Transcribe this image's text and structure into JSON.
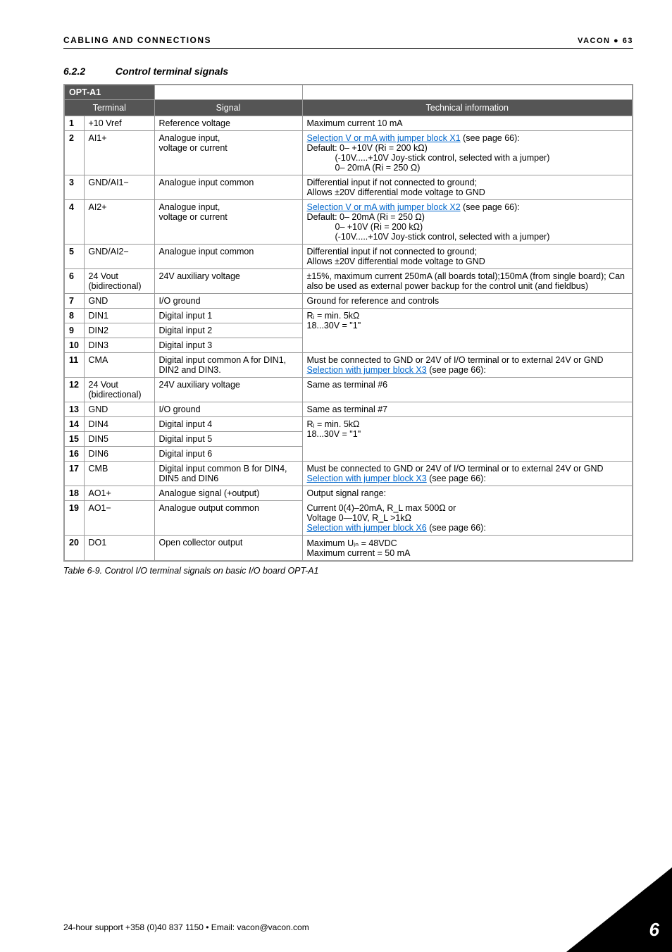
{
  "header": {
    "left": "CABLING AND CONNECTIONS",
    "right_brand": "VACON",
    "right_bullet": "●",
    "right_page": "63"
  },
  "section": {
    "number": "6.2.2",
    "title": "Control terminal signals"
  },
  "tableHeader": {
    "opt": "OPT-A1",
    "terminal": "Terminal",
    "signal": "Signal",
    "techinfo": "Technical information"
  },
  "rows": {
    "r1": {
      "n": "1",
      "t": "+10 Vref",
      "s": "Reference voltage",
      "ti": "Maximum current 10 mA"
    },
    "r2": {
      "n": "2",
      "t": "AI1+",
      "s": "Analogue input,\nvoltage or current",
      "link": "Selection V or mA with jumper block X1",
      "after_link": " (see page 66):",
      "l1": "Default: 0– +10V (Ri = 200 kΩ)",
      "l2": "(-10V.....+10V Joy-stick control, selected with a jumper)",
      "l3": "0– 20mA (Ri = 250 Ω)"
    },
    "r3": {
      "n": "3",
      "t": "GND/AI1−",
      "s": "Analogue input common",
      "l1": "Differential input if not connected to ground;",
      "l2": "Allows ±20V differential mode voltage to GND"
    },
    "r4": {
      "n": "4",
      "t": "AI2+",
      "s": "Analogue input,\nvoltage or current",
      "link": "Selection V or mA with jumper block X2",
      "after_link": " (see page 66):",
      "l1": "Default: 0– 20mA (Ri = 250 Ω)",
      "l2": "0– +10V (Ri = 200 kΩ)",
      "l3": "(-10V.....+10V Joy-stick control, selected with a jumper)"
    },
    "r5": {
      "n": "5",
      "t": "GND/AI2−",
      "s": "Analogue input common",
      "l1": "Differential input if not connected to ground;",
      "l2": "Allows ±20V differential mode voltage to GND"
    },
    "r6": {
      "n": "6",
      "t": "24 Vout\n(bidirectional)",
      "s": "24V auxiliary voltage",
      "l1": "±15%, maximum current 250mA (all boards total);150mA (from single board); Can also be used as external power backup for the control unit (and fieldbus)"
    },
    "r7": {
      "n": "7",
      "t": "GND",
      "s": "I/O ground",
      "ti": "Ground for reference and controls"
    },
    "r8": {
      "n": "8",
      "t": "DIN1",
      "s": "Digital input 1"
    },
    "r9": {
      "n": "9",
      "t": "DIN2",
      "s": "Digital input 2"
    },
    "r10": {
      "n": "10",
      "t": "DIN3",
      "s": "Digital input 3"
    },
    "din_block": {
      "l1": "Rᵢ = min. 5kΩ",
      "l2": "18...30V = \"1\""
    },
    "r11": {
      "n": "11",
      "t": "CMA",
      "s": "Digital input common A for DIN1, DIN2 and DIN3.",
      "l1": "Must be connected to GND or 24V of I/O terminal or to external 24V or GND",
      "link": "Selection with jumper block X3",
      "after_link": " (see page 66):"
    },
    "r12": {
      "n": "12",
      "t": "24 Vout\n(bidirectional)",
      "s": "24V auxiliary voltage",
      "ti": "Same as terminal #6"
    },
    "r13": {
      "n": "13",
      "t": "GND",
      "s": "I/O ground",
      "ti": "Same as terminal #7"
    },
    "r14": {
      "n": "14",
      "t": "DIN4",
      "s": "Digital input 4"
    },
    "r15": {
      "n": "15",
      "t": "DIN5",
      "s": "Digital input 5"
    },
    "r16": {
      "n": "16",
      "t": "DIN6",
      "s": "Digital input 6"
    },
    "din_block2": {
      "l1": "Rᵢ = min. 5kΩ",
      "l2": "18...30V = \"1\""
    },
    "r17": {
      "n": "17",
      "t": "CMB",
      "s": "Digital input common B for DIN4, DIN5 and DIN6",
      "l1": "Must be connected to GND or 24V of I/O terminal or to external 24V or GND",
      "link": "Selection with jumper block X3",
      "after_link": " (see page 66):"
    },
    "r18": {
      "n": "18",
      "t": "AO1+",
      "s": "Analogue signal (+output)",
      "ti": "Output signal range:"
    },
    "r19": {
      "n": "19",
      "t": "AO1−",
      "s": "Analogue output common",
      "l1": "Current 0(4)–20mA, R_L max 500Ω or",
      "l2": "Voltage 0—10V, R_L >1kΩ",
      "link": "Selection with jumper block X6",
      "after_link": " (see page 66):"
    },
    "r20": {
      "n": "20",
      "t": "DO1",
      "s": "Open collector output",
      "l1": "Maximum Uᵢₙ = 48VDC",
      "l2": "Maximum current = 50 mA"
    }
  },
  "caption": "Table 6-9. Control I/O terminal signals on basic I/O board OPT-A1",
  "footer": "24-hour support +358 (0)40 837 1150 • Email: vacon@vacon.com",
  "corner_page": "6"
}
